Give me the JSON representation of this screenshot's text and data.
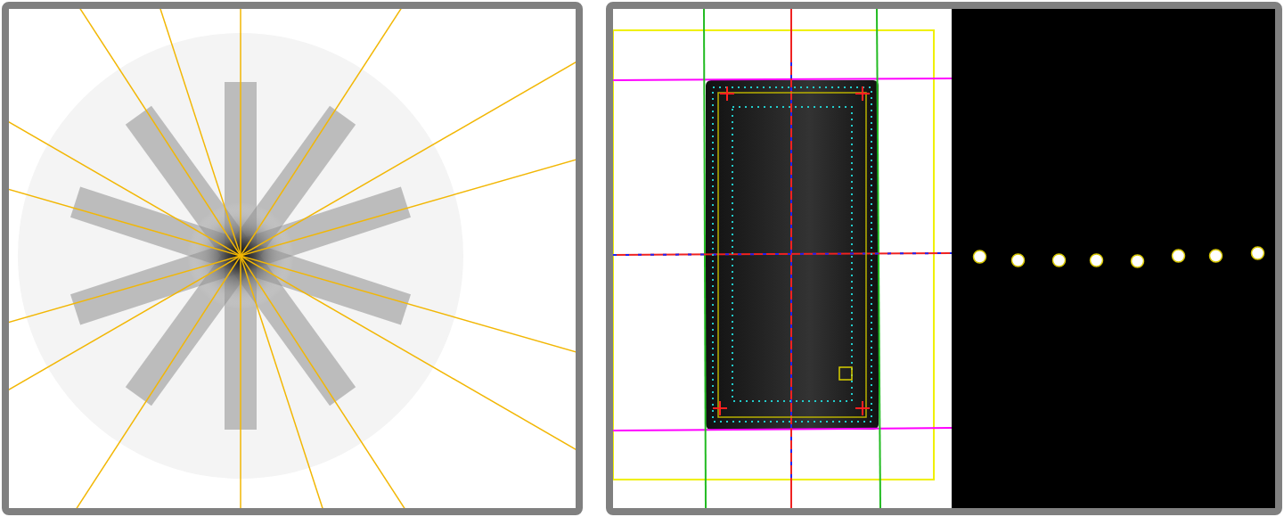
{
  "panels": [
    {
      "kind": "starshot"
    },
    {
      "kind": "field-analysis"
    }
  ]
}
